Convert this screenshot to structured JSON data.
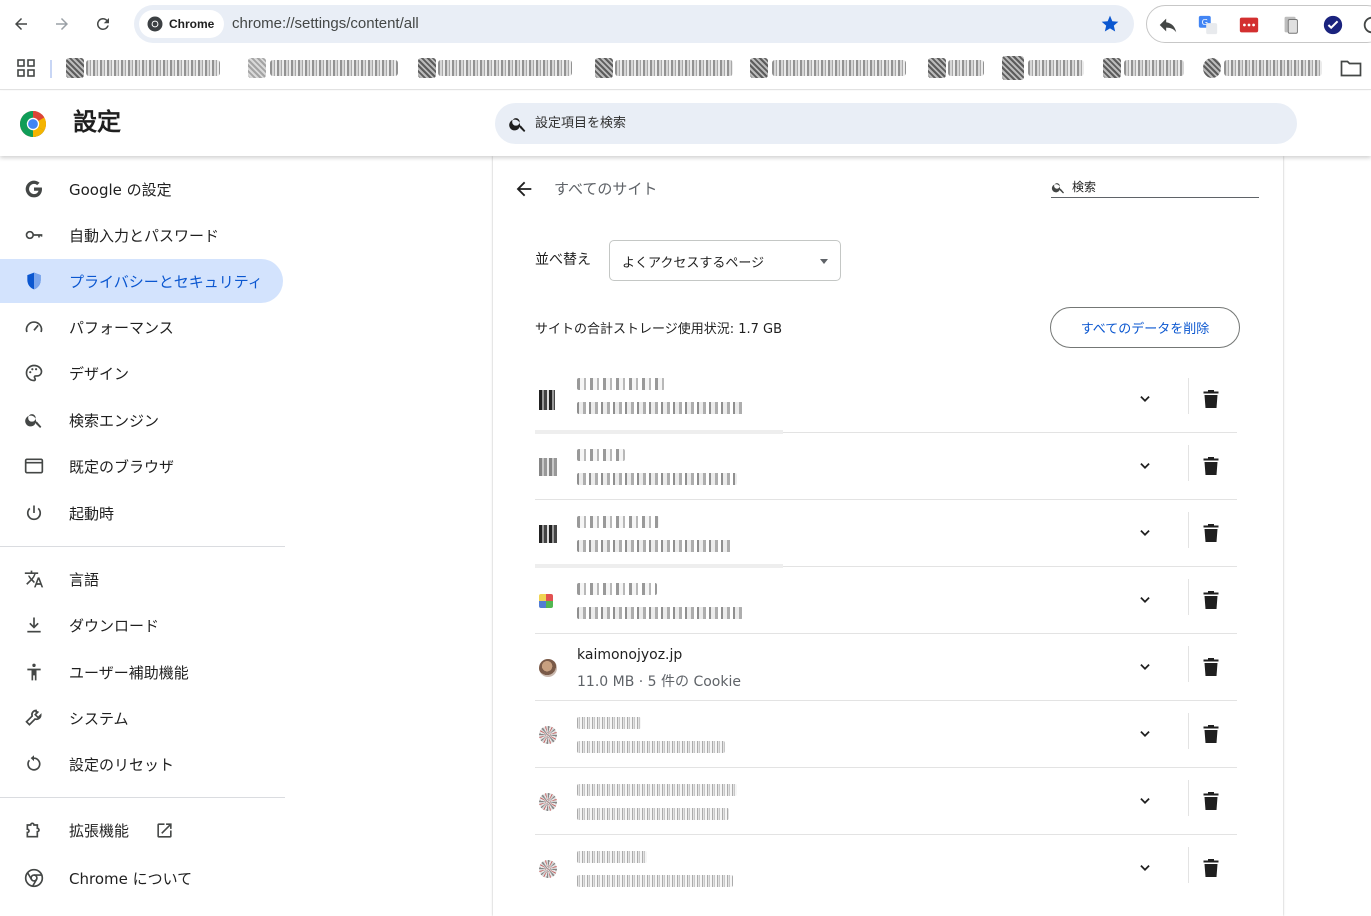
{
  "browser": {
    "chip_label": "Chrome",
    "url": "chrome://settings/content/all"
  },
  "settings_header": {
    "title": "設定",
    "search_placeholder": "設定項目を検索"
  },
  "sidebar": {
    "items": [
      {
        "label": "Google の設定",
        "icon": "google-g-icon",
        "active": false
      },
      {
        "label": "自動入力とパスワード",
        "icon": "key-icon",
        "active": false
      },
      {
        "label": "プライバシーとセキュリティ",
        "icon": "shield-icon",
        "active": true
      },
      {
        "label": "パフォーマンス",
        "icon": "speedometer-icon",
        "active": false
      },
      {
        "label": "デザイン",
        "icon": "palette-icon",
        "active": false
      },
      {
        "label": "検索エンジン",
        "icon": "search-icon",
        "active": false
      },
      {
        "label": "既定のブラウザ",
        "icon": "browser-window-icon",
        "active": false
      },
      {
        "label": "起動時",
        "icon": "power-icon",
        "active": false
      },
      {
        "label": "言語",
        "icon": "translate-icon",
        "active": false
      },
      {
        "label": "ダウンロード",
        "icon": "download-icon",
        "active": false
      },
      {
        "label": "ユーザー補助機能",
        "icon": "accessibility-icon",
        "active": false
      },
      {
        "label": "システム",
        "icon": "wrench-icon",
        "active": false
      },
      {
        "label": "設定のリセット",
        "icon": "reset-icon",
        "active": false
      },
      {
        "label": "拡張機能",
        "icon": "extension-puzzle-icon",
        "active": false
      },
      {
        "label": "Chrome について",
        "icon": "chrome-logo-icon",
        "active": false
      }
    ]
  },
  "main": {
    "page_title": "すべてのサイト",
    "search_placeholder": "検索",
    "sort_label": "並べ替え",
    "sort_value": "よくアクセスするページ",
    "storage_text": "サイトの合計ストレージ使用状況: 1.7 GB",
    "delete_all_label": "すべてのデータを削除",
    "sites": [
      {
        "name": "kaimonojyoz.jp",
        "meta": "11.0 MB · 5 件の Cookie"
      }
    ]
  },
  "colors": {
    "accent": "#0b57d0",
    "active_bg": "#d3e3fd",
    "omnibox_bg": "#e9eef6"
  }
}
